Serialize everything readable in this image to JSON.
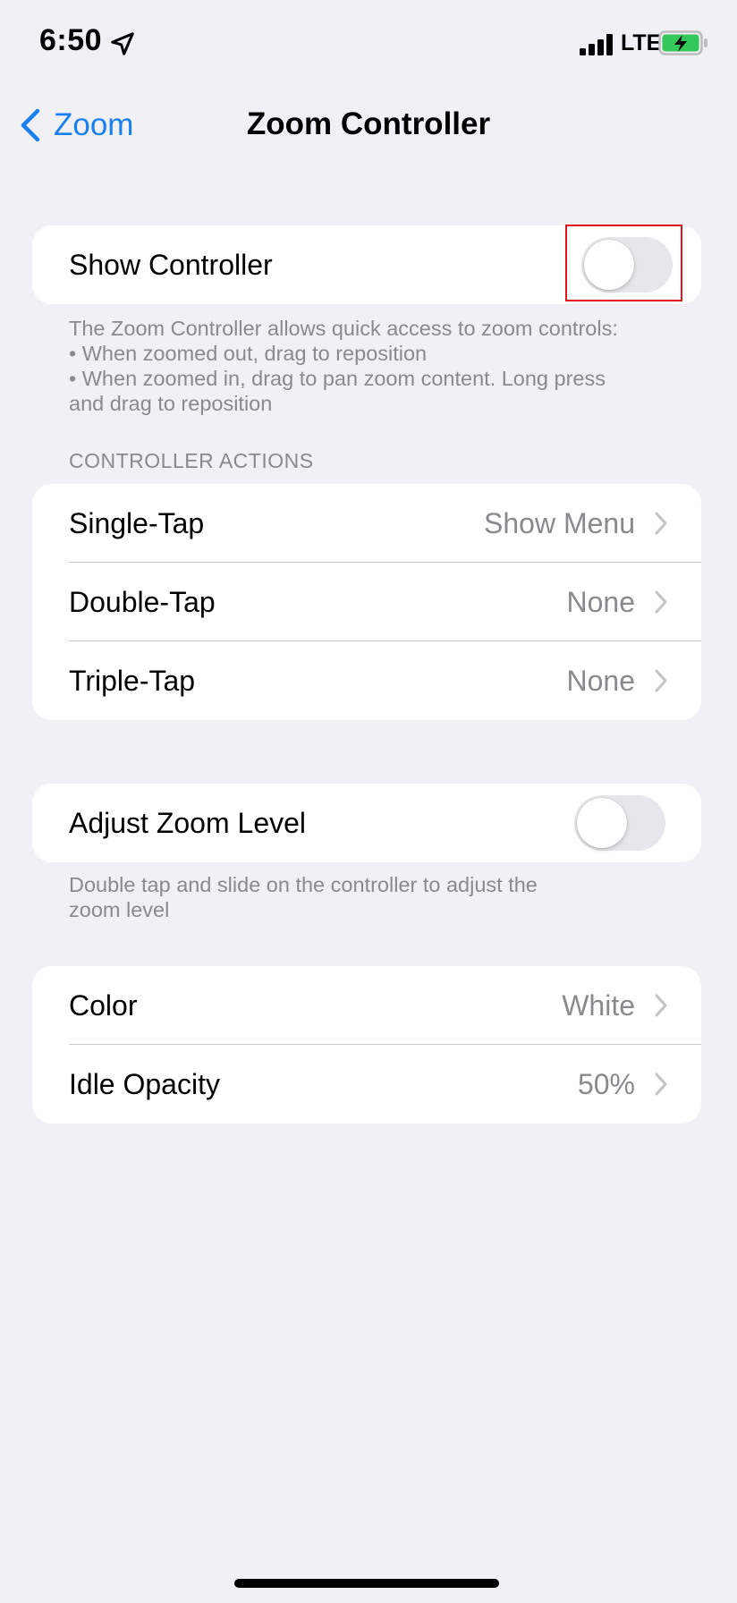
{
  "status_bar": {
    "time": "6:50",
    "network": "LTE",
    "icons": [
      "location-arrow-icon",
      "cellular-signal-icon",
      "battery-charging-icon"
    ],
    "battery_color": "#34C759"
  },
  "nav": {
    "back_label": "Zoom",
    "title": "Zoom Controller"
  },
  "show_controller": {
    "label": "Show Controller",
    "enabled": false
  },
  "info_footnote": {
    "lines": [
      "The Zoom Controller allows quick access to zoom controls:",
      "• When zoomed out, drag to reposition",
      "• When zoomed in, drag to pan zoom content. Long press",
      "and drag to reposition"
    ]
  },
  "controller_actions": {
    "header": "CONTROLLER ACTIONS",
    "rows": [
      {
        "label": "Single-Tap",
        "value": "Show Menu"
      },
      {
        "label": "Double-Tap",
        "value": "None"
      },
      {
        "label": "Triple-Tap",
        "value": "None"
      }
    ]
  },
  "adjust_zoom": {
    "label": "Adjust Zoom Level",
    "enabled": false,
    "footnote_lines": [
      "Double tap and slide on the controller to adjust the",
      "zoom level"
    ]
  },
  "appearance": {
    "rows": [
      {
        "label": "Color",
        "value": "White"
      },
      {
        "label": "Idle Opacity",
        "value": "50%"
      }
    ]
  },
  "colors": {
    "accent": "#1A80F0",
    "background": "#F0F0F5",
    "highlight": "#E0141E"
  }
}
